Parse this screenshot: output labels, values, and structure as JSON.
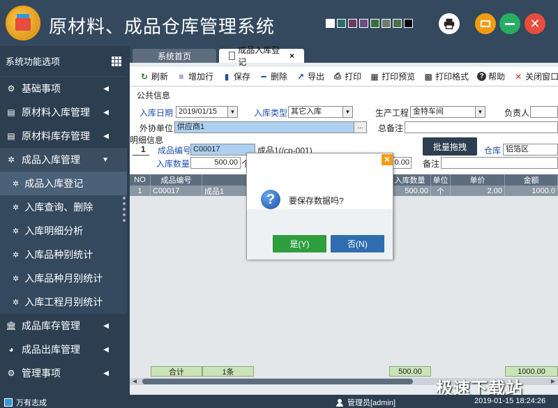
{
  "app": {
    "title": "原材料、成品仓库管理系统",
    "theme_colors": [
      "#ffffff",
      "#2e6d6d",
      "#6d3b5d",
      "#6d4e7d",
      "#3b6d3b",
      "#6d7d6d",
      "#4e6d4e",
      "#000000"
    ]
  },
  "sidebar": {
    "header": "系统功能选项",
    "items": [
      {
        "label": "基础事项",
        "icon": "settings-icon"
      },
      {
        "label": "原材料入库管理",
        "icon": "box-icon"
      },
      {
        "label": "原材料库存管理",
        "icon": "box-icon"
      },
      {
        "label": "成品入库管理",
        "icon": "gear-icon"
      }
    ],
    "subitems": [
      {
        "label": "成品入库登记"
      },
      {
        "label": "入库查询、删除"
      },
      {
        "label": "入库明细分析"
      },
      {
        "label": "入库品种别统计"
      },
      {
        "label": "入库品种月别统计"
      },
      {
        "label": "入库工程月别统计"
      }
    ],
    "bottom_items": [
      {
        "label": "成品库存管理",
        "icon": "bank-icon"
      },
      {
        "label": "成品出库管理",
        "icon": "pie-icon"
      },
      {
        "label": "管理事项",
        "icon": "gear-icon"
      }
    ]
  },
  "tabs": {
    "home": "系统首页",
    "current": "成品入库登记",
    "close": "×"
  },
  "toolbar": {
    "refresh": "刷新",
    "add_row": "增加行",
    "save": "保存",
    "delete": "删除",
    "export": "导出",
    "print": "打印",
    "print_preview": "打印预览",
    "print_format": "打印格式",
    "help": "帮助",
    "close_window": "关闭窗口"
  },
  "form": {
    "public_info": "公共信息",
    "date_label": "入库日期",
    "date_value": "2019/01/15",
    "type_label": "入库类型",
    "type_value": "其它入库",
    "workshop_label": "生产工程",
    "workshop_value": "金特车间",
    "owner_label": "负责人",
    "partner_label": "外协单位",
    "partner_value": "供应商1",
    "partner_btn": "...",
    "remark_label": "总备注",
    "detail_info": "明细信息",
    "row_no": "1",
    "code_label": "成品编号",
    "code_value": "C00017",
    "code_desc": "成品1(/cp-001)",
    "qty_label": "入库数量",
    "qty_value": "500.00",
    "unit_value": "个",
    "amount_value": "0.00",
    "note_label": "备注",
    "batch_btn": "批量拖拽",
    "warehouse_label": "仓库",
    "warehouse_value": "铝箔区"
  },
  "grid": {
    "headers": [
      "NO",
      "成品编号",
      "品名",
      "入库数量",
      "单位",
      "单价",
      "金额"
    ],
    "rows": [
      [
        "1",
        "C00017",
        "成品1",
        "500.00",
        "个",
        "2.00",
        "1000.0"
      ]
    ],
    "summary": {
      "label": "合计",
      "count": "1条",
      "qty_total": "500.00",
      "amount_total": "1000.00"
    }
  },
  "dialog": {
    "message": "要保存数据吗?",
    "yes": "是(Y)",
    "no": "否(N)",
    "close": "×"
  },
  "status": {
    "company": "万有志成",
    "user": "管理员[admin]",
    "time": "2019-01-15 18:24:26"
  },
  "watermark": "极速下载站"
}
